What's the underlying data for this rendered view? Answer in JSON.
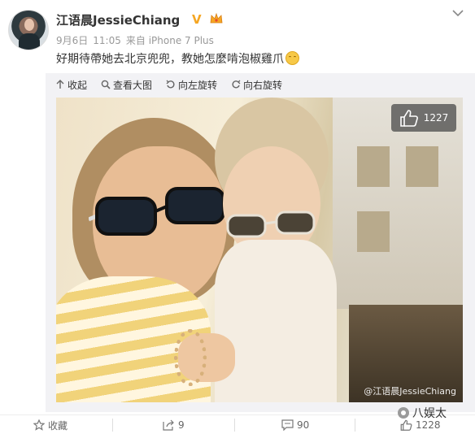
{
  "post": {
    "username": "江语晨JessieChiang",
    "verified_badge": "V",
    "crown_icon": "crown-icon",
    "date": "9月6日",
    "time": "11:05",
    "source": "来自 iPhone 7 Plus",
    "text": "好期待帶她去北京兜兜，教她怎麼啃泡椒雞爪"
  },
  "toolbar": {
    "collapse": "收起",
    "view_large": "查看大图",
    "rotate_left": "向左旋转",
    "rotate_right": "向右旋转"
  },
  "photo": {
    "like_count": "1227",
    "watermark": "@江语晨JessieChiang"
  },
  "footer": {
    "favorite": "收藏",
    "share_count": "9",
    "comment_count": "90",
    "like_count": "1228",
    "brand": "八娱太"
  },
  "colors": {
    "accent": "#f5a623",
    "panel_bg": "#f2f2f5",
    "text": "#333333",
    "muted": "#999999"
  }
}
